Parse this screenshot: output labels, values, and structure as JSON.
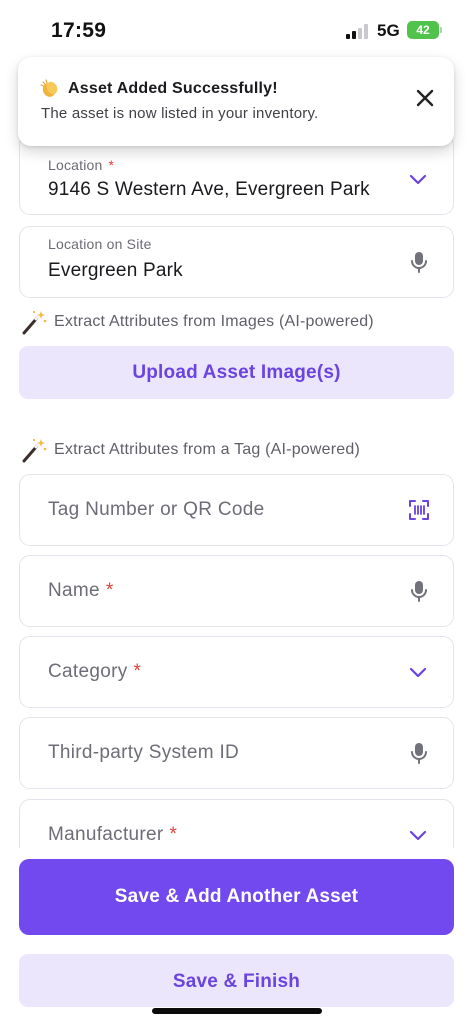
{
  "status_bar": {
    "time": "17:59",
    "network": "5G",
    "battery": "42"
  },
  "toast": {
    "title": "Asset Added Successfully!",
    "message": "The asset is now listed in your inventory.",
    "emoji_icon": "clapping-hands-icon",
    "close_icon": "close-icon"
  },
  "form": {
    "location": {
      "label": "Location",
      "required_mark": "*",
      "value": "9146 S Western Ave, Evergreen Park"
    },
    "location_on_site": {
      "label": "Location on Site",
      "value": "Evergreen Park"
    },
    "image_extract": {
      "label": "Extract Attributes from Images (AI-powered)",
      "button": "Upload Asset Image(s)"
    },
    "tag_extract": {
      "label": "Extract Attributes from a Tag (AI-powered)"
    },
    "tag_number": {
      "placeholder": "Tag Number or QR Code"
    },
    "name": {
      "placeholder": "Name",
      "required_mark": "*"
    },
    "category": {
      "placeholder": "Category",
      "required_mark": "*"
    },
    "third_party_id": {
      "placeholder": "Third-party System ID"
    },
    "manufacturer": {
      "placeholder": "Manufacturer",
      "required_mark": "*"
    }
  },
  "actions": {
    "save_add_another": "Save & Add Another Asset",
    "save_finish": "Save & Finish"
  },
  "colors": {
    "accent": "#7149ef",
    "accent_soft": "#ebe6fb",
    "required": "#e0413a",
    "battery": "#4fc34c"
  }
}
